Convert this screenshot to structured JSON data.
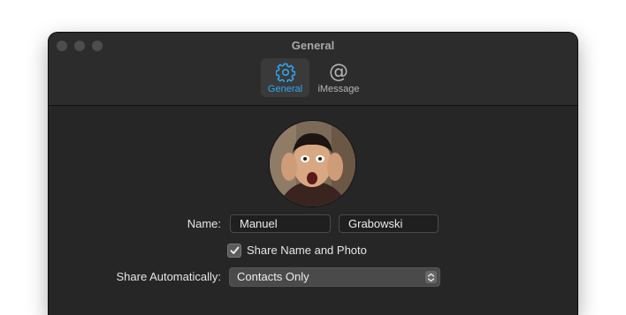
{
  "window": {
    "title": "General"
  },
  "toolbar": {
    "tabs": [
      {
        "label": "General",
        "icon": "gear-icon",
        "selected": true
      },
      {
        "label": "iMessage",
        "icon": "at-icon",
        "selected": false
      }
    ]
  },
  "form": {
    "name_label": "Name:",
    "first_name": "Manuel",
    "last_name": "Grabowski",
    "share_checkbox_label": "Share Name and Photo",
    "share_checkbox_checked": true,
    "share_auto_label": "Share Automatically:",
    "share_auto_value": "Contacts Only"
  },
  "colors": {
    "accent": "#2fa8f5",
    "window_bg": "#262626"
  }
}
